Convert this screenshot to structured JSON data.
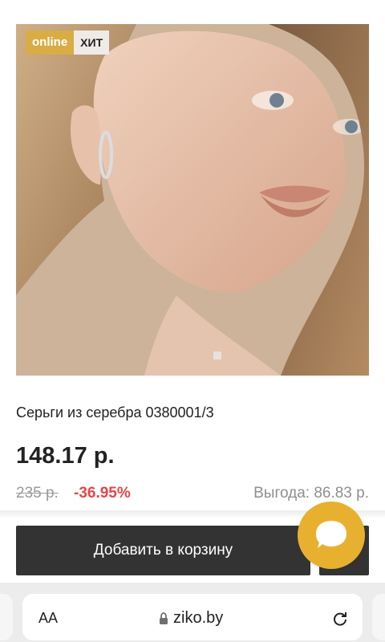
{
  "badges": {
    "online": "online",
    "hit": "ХИТ"
  },
  "product": {
    "title": "Серьги из серебра 0380001/3",
    "price": "148.17 р.",
    "old_price": "235 р.",
    "discount": "-36.95%",
    "benefit": "Выгода: 86.83 р.",
    "image_icon": "product-photo"
  },
  "actions": {
    "add_to_cart": "Добавить в корзину",
    "chat_icon": "chat-bubble-icon"
  },
  "browser": {
    "aa": "АA",
    "url": "ziko.by",
    "lock_icon": "lock-icon",
    "reload_icon": "reload-icon"
  },
  "colors": {
    "accent": "#d9ad45",
    "discount": "#e14848",
    "button": "#333333",
    "chat": "#e8b02f"
  }
}
